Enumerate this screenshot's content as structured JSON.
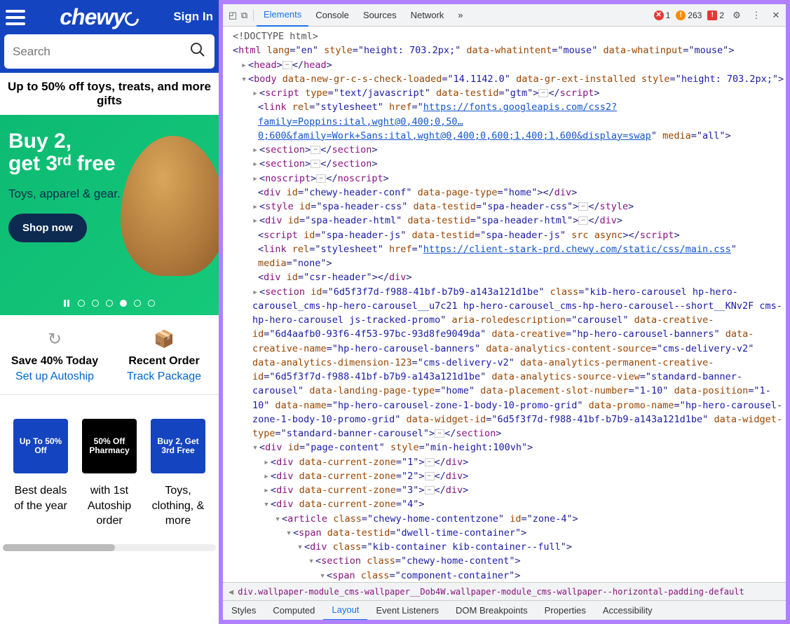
{
  "site": {
    "logo": "chewy",
    "signin": "Sign In",
    "search_placeholder": "Search",
    "promo_bar": "Up to 50% off toys, treats, and more gifts",
    "hero": {
      "line1": "Buy 2,",
      "line2": "get 3ʳᵈ free",
      "sub": "Toys, apparel & gear.",
      "cta": "Shop now"
    },
    "quick_actions": [
      {
        "title": "Save 40% Today",
        "link": "Set up Autoship"
      },
      {
        "title": "Recent Order",
        "link": "Track Package"
      }
    ],
    "cards": [
      {
        "img": "Up To 50% Off",
        "label": "Best deals of the year"
      },
      {
        "img": "50% Off Pharmacy",
        "label": "with 1st Autoship order"
      },
      {
        "img": "Buy 2, Get 3rd Free",
        "label": "Toys, clothing, & more"
      }
    ]
  },
  "devtools": {
    "tabs": [
      "Elements",
      "Console",
      "Sources",
      "Network"
    ],
    "active_tab": "Elements",
    "more": "»",
    "errors": {
      "error": "1",
      "warn": "263",
      "issue": "2"
    },
    "doctype": "<!DOCTYPE html>",
    "html_attrs": {
      "lang": "en",
      "style": "height: 703.2px;",
      "data-whatintent": "mouse",
      "data-whatinput": "mouse"
    },
    "body_attrs": {
      "data-new-gr-c-s-check-loaded": "14.1142.0",
      "data-gr-ext-installed": "",
      "style": "height: 703.2px;"
    },
    "script1": {
      "type": "text/javascript",
      "data-testid": "gtm"
    },
    "link1": {
      "rel": "stylesheet",
      "href": "https://fonts.googleapis.com/css2?family=Poppins:ital,wght@0,400;0,50…0;600&family=Work+Sans:ital,wght@0,400;0,600;1,400;1,600&display=swap",
      "media": "all"
    },
    "div1": {
      "id": "chewy-header-conf",
      "data-page-type": "home"
    },
    "style1": {
      "id": "spa-header-css",
      "data-testid": "spa-header-css"
    },
    "div2": {
      "id": "spa-header-html",
      "data-testid": "spa-header-html"
    },
    "script2": {
      "id": "spa-header-js",
      "data-testid": "spa-header-js",
      "src": "",
      "async": ""
    },
    "link2": {
      "rel": "stylesheet",
      "href": "https://client-stark-prd.chewy.com/static/css/main.css",
      "media": "none"
    },
    "div3": {
      "id": "csr-header"
    },
    "section_hero": {
      "id": "6d5f3f7d-f988-41bf-b7b9-a143a121d1be",
      "class": "kib-hero-carousel hp-hero-carousel_cms-hp-hero-carousel__u7c21 hp-hero-carousel_cms-hp-hero-carousel--short__KNv2F cms-hp-hero-carousel js-tracked-promo",
      "aria-roledescription": "carousel",
      "data-creative-id": "6d4aafb0-93f6-4f53-97bc-93d8fe9049da",
      "data-creative": "hp-hero-carousel-banners",
      "data-creative-name": "hp-hero-carousel-banners",
      "data-analytics-content-source": "cms-delivery-v2",
      "data-analytics-dimension-123": "cms-delivery-v2",
      "data-analytics-permanent-creative-id": "6d5f3f7d-f988-41bf-b7b9-a143a121d1be",
      "data-analytics-source-view": "standard-banner-carousel",
      "data-landing-page-type": "home",
      "data-placement-slot-number": "1-10",
      "data-position": "1-10",
      "data-name": "hp-hero-carousel-zone-1-body-10-promo-grid",
      "data-promo-name": "hp-hero-carousel-zone-1-body-10-promo-grid",
      "data-widget-id": "6d5f3f7d-f988-41bf-b7b9-a143a121d1be",
      "data-widget-type": "standard-banner-carousel"
    },
    "page_content": {
      "id": "page-content",
      "style": "min-height:100vh"
    },
    "zones": [
      "1",
      "2",
      "3",
      "4"
    ],
    "article": {
      "class": "chewy-home-contentzone",
      "id": "zone-4"
    },
    "span_testid": "dwell-time-container",
    "div_kib": "kib-container kib-container--full",
    "section_chc": "chewy-home-content",
    "span_comp": "component-container",
    "breadcrumb": "div.wallpaper-module_cms-wallpaper__Dob4W.wallpaper-module_cms-wallpaper--horizontal-padding-default",
    "styles_tabs": [
      "Styles",
      "Computed",
      "Layout",
      "Event Listeners",
      "DOM Breakpoints",
      "Properties",
      "Accessibility"
    ],
    "active_styles_tab": "Layout"
  }
}
